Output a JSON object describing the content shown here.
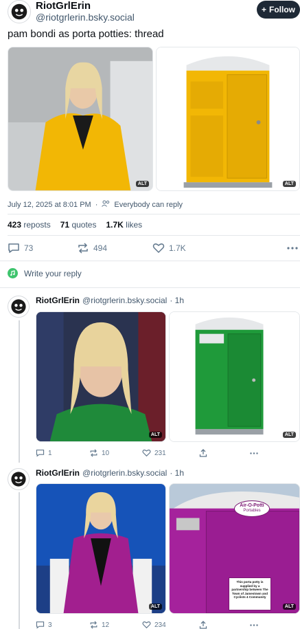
{
  "post": {
    "author_name": "RiotGrlErin",
    "author_handle": "@riotgrlerin.bsky.social",
    "follow_label": "Follow",
    "text": "pam bondi as porta potties: thread",
    "alt_label": "ALT",
    "timestamp": "July 12, 2025 at 8:01 PM",
    "reply_scope": "Everybody can reply",
    "stats": {
      "reposts_count": "423",
      "reposts_label": "reposts",
      "quotes_count": "71",
      "quotes_label": "quotes",
      "likes_count": "1.7K",
      "likes_label": "likes"
    },
    "actions": {
      "replies": "73",
      "reposts": "494",
      "likes": "1.7K"
    }
  },
  "reply_box": {
    "placeholder": "Write your reply"
  },
  "thread": [
    {
      "author_name": "RiotGrlErin",
      "author_handle": "@riotgrlerin.bsky.social",
      "age": "· 1h",
      "replies": "1",
      "reposts": "10",
      "likes": "231",
      "toilet_color": "#1f9a3a"
    },
    {
      "author_name": "RiotGrlErin",
      "author_handle": "@riotgrlerin.bsky.social",
      "age": "· 1h",
      "replies": "3",
      "reposts": "12",
      "likes": "234",
      "toilet_color": "#a5229c",
      "sign": {
        "brand": "Air-O-Potti",
        "brand_sub": "Portables",
        "notice": "This porta potty is supplied by a partnership between The Town of Jamestown and Cyclists 4 Community"
      }
    }
  ],
  "colors": {
    "accent": "#1083fe",
    "follow_bg": "#1e2936",
    "yellow": "#f2b705"
  }
}
